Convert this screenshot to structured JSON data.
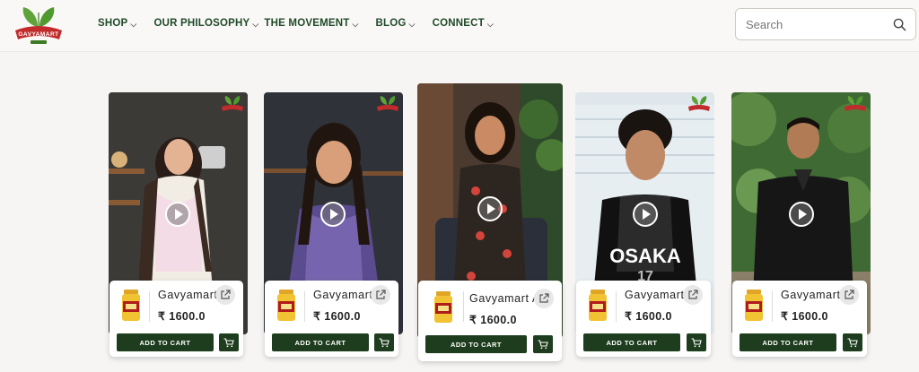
{
  "brand": {
    "name": "GAVYAMART",
    "tagline": ""
  },
  "nav": [
    {
      "label": "SHOP"
    },
    {
      "label": "OUR PHILOSOPHY"
    },
    {
      "label": "THE MOVEMENT"
    },
    {
      "label": "BLOG"
    },
    {
      "label": "CONNECT"
    }
  ],
  "search": {
    "placeholder": "Search"
  },
  "colors": {
    "primary": "#1e3d1e",
    "nav_text": "#1f4a2a",
    "background": "#f7f5f3"
  },
  "cards": [
    {
      "product_name": "Gavyamart A2",
      "price": "₹ 1600.0",
      "add_to_cart": "ADD TO CART"
    },
    {
      "product_name": "Gavyamart A2",
      "price": "₹ 1600.0",
      "add_to_cart": "ADD TO CART"
    },
    {
      "product_name": "Gavyamart A2",
      "price": "₹ 1600.0",
      "add_to_cart": "ADD TO CART"
    },
    {
      "product_name": "Gavyamart A2",
      "price": "₹ 1600.0",
      "add_to_cart": "ADD TO CART"
    },
    {
      "product_name": "Gavyamart A2",
      "price": "₹ 1600.0",
      "add_to_cart": "ADD TO CART"
    }
  ],
  "icons": [
    "logo",
    "chevron-down-icon",
    "search-icon",
    "play-icon",
    "share-icon",
    "cart-icon",
    "ghee-jar-icon"
  ]
}
